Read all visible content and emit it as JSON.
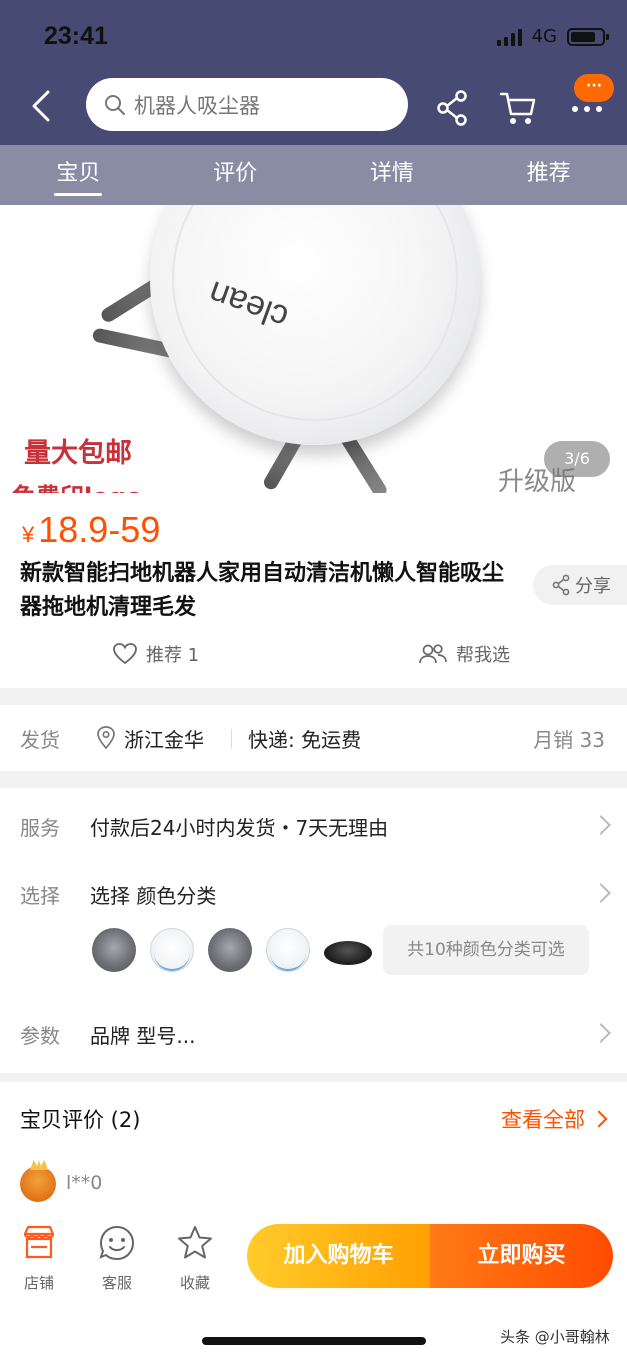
{
  "status_bar": {
    "time": "23:41",
    "network": "4G"
  },
  "header": {
    "search_placeholder": "机器人吸尘器",
    "icons": [
      "back-icon",
      "search-icon",
      "share-icon",
      "cart-icon",
      "more-icon"
    ],
    "more_badge": "···"
  },
  "tabs": [
    {
      "label": "宝贝",
      "active": true
    },
    {
      "label": "评价",
      "active": false
    },
    {
      "label": "详情",
      "active": false
    },
    {
      "label": "推荐",
      "active": false
    }
  ],
  "hero": {
    "promo_1": "量大包邮",
    "promo_2": "免费印logo",
    "upgrade": "升级版",
    "counter": "3/6",
    "robot_logo": "clean"
  },
  "product": {
    "currency": "¥",
    "price": "18.9-59",
    "title": "新款智能扫地机器人家用自动清洁机懒人智能吸尘器拖地机清理毛发",
    "share_label": "分享",
    "recommend_label": "推荐 1",
    "help_label": "帮我选"
  },
  "shipping": {
    "label": "发货",
    "location": "浙江金华",
    "express": "快递: 免运费",
    "monthly_sales": "月销 33"
  },
  "service": {
    "service_label": "服务",
    "service_text": "付款后24小时内发货・7天无理由",
    "select_label": "选择",
    "select_text": "选择  颜色分类",
    "color_count": "共10种颜色分类可选",
    "params_label": "参数",
    "params_text": "品牌  型号..."
  },
  "reviews": {
    "title": "宝贝评价 (2)",
    "view_all": "查看全部",
    "first_user": "l**0"
  },
  "bottom_bar": {
    "shop": "店铺",
    "service": "客服",
    "favorite": "收藏",
    "add_to_cart": "加入购物车",
    "buy_now": "立即购买"
  },
  "watermark": "头条 @小哥翰林",
  "colors": {
    "header_bg": "#474b74",
    "tabs_bg": "#8a8ca3",
    "price": "#ff5000",
    "cart_btn": "#ffa000",
    "buy_btn": "#ff5000"
  }
}
